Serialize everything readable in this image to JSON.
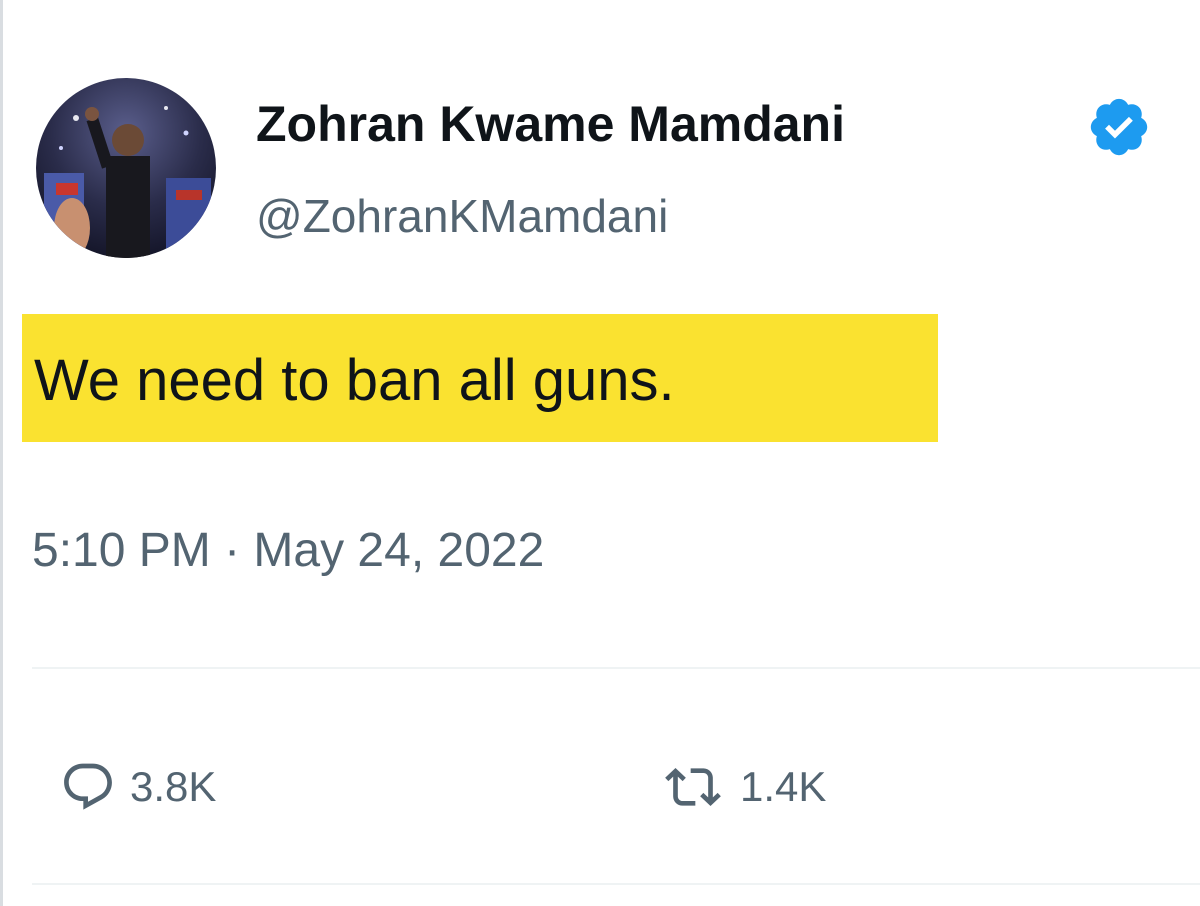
{
  "tweet": {
    "author": {
      "display_name": "Zohran Kwame Mamdani",
      "handle": "@ZohranKMamdani",
      "verified": true,
      "avatar_icon": "profile-photo"
    },
    "text": "We need to ban all guns.",
    "highlight_color": "#fae230",
    "timestamp": "5:10 PM · May 24, 2022",
    "actions": {
      "reply": {
        "icon": "reply-bubble-icon",
        "count": "3.8K"
      },
      "retweet": {
        "icon": "retweet-icon",
        "count": "1.4K"
      }
    }
  },
  "colors": {
    "text_primary": "#0f1419",
    "text_secondary": "#536471",
    "verified_blue": "#1d9bf0",
    "divider": "#eff3f4"
  }
}
